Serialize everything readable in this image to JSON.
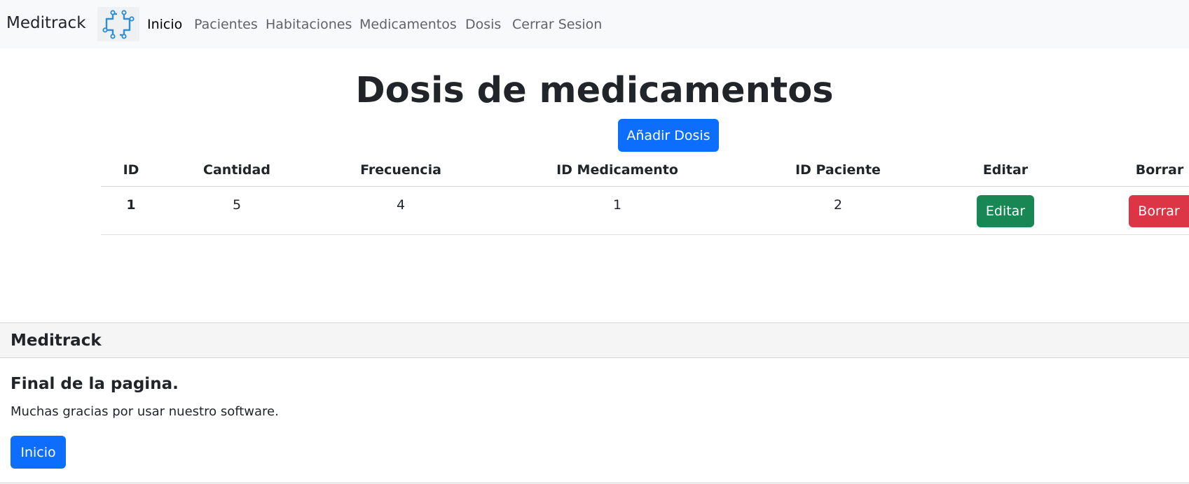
{
  "navbar": {
    "brand": "Meditrack",
    "links": [
      "Inicio",
      "Pacientes",
      "Habitaciones",
      "Medicamentos",
      "Dosis",
      "Cerrar Sesion"
    ]
  },
  "main": {
    "title": "Dosis de medicamentos",
    "add_button": "Añadir Dosis",
    "table": {
      "columns": [
        "ID",
        "Cantidad",
        "Frecuencia",
        "ID Medicamento",
        "ID Paciente",
        "Editar",
        "Borrar"
      ],
      "rows": [
        {
          "id": "1",
          "cantidad": "5",
          "frecuencia": "4",
          "id_medicamento": "1",
          "id_paciente": "2",
          "edit_label": "Editar",
          "delete_label": "Borrar"
        }
      ]
    }
  },
  "footer": {
    "brand": "Meditrack",
    "title": "Final de la pagina.",
    "text": "Muchas gracias por usar nuestro software.",
    "button": "Inicio"
  },
  "colors": {
    "primary": "#0d6efd",
    "success": "#198754",
    "danger": "#dc3545",
    "navbar_bg": "#f8f9fa"
  },
  "icons": {
    "logo": "circuit-cross-logo"
  }
}
